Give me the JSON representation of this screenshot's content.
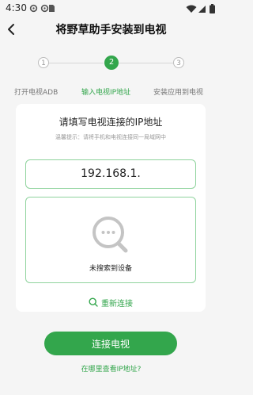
{
  "status_bar": {
    "time": "4:30"
  },
  "header": {
    "title": "将野草助手安装到电视"
  },
  "steps": [
    {
      "number": "1",
      "label": "打开电视ADB",
      "state": "inactive"
    },
    {
      "number": "2",
      "label": "输入电视IP地址",
      "state": "active"
    },
    {
      "number": "3",
      "label": "安装应用到电视",
      "state": "inactive"
    }
  ],
  "card": {
    "title": "请填写电视连接的IP地址",
    "tip": "温馨提示：请将手机和电视连接同一局域网中",
    "ip_value": "192.168.1.",
    "empty_text": "未搜索到设备",
    "rescan_label": "重新连接"
  },
  "connect_button": "连接电视",
  "help_link": "在哪里查看IP地址?",
  "colors": {
    "accent": "#33a64c",
    "border": "#8fd39d",
    "background": "#f5f5f5"
  }
}
